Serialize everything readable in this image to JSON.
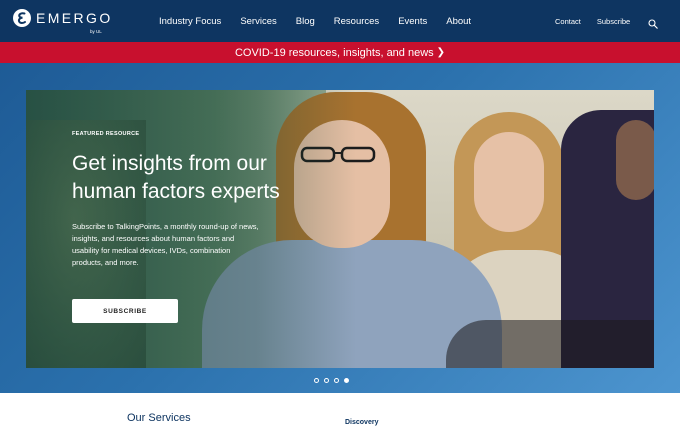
{
  "header": {
    "logo_text": "EMERGO",
    "logo_sub": "by UL",
    "nav_main": [
      "Industry Focus",
      "Services",
      "Blog",
      "Resources",
      "Events",
      "About"
    ],
    "nav_right": [
      "Contact",
      "Subscribe"
    ],
    "search_icon": "search-icon"
  },
  "banner": {
    "text": "COVID-19 resources, insights, and news",
    "chevron": "❯"
  },
  "hero": {
    "eyebrow": "FEATURED RESOURCE",
    "title": "Get insights from our human factors experts",
    "description": "Subscribe to TalkingPoints, a monthly round-up of news, insights, and resources about human factors and usability for medical devices, IVDs, combination products, and more.",
    "button_label": "SUBSCRIBE",
    "slides_total": 4,
    "active_slide": 4
  },
  "below": {
    "section_title": "Our Services",
    "column_heading": "Discovery"
  },
  "colors": {
    "header_bg": "#0e3561",
    "banner_bg": "#c8102e",
    "hero_bg": "#2b71ad"
  }
}
